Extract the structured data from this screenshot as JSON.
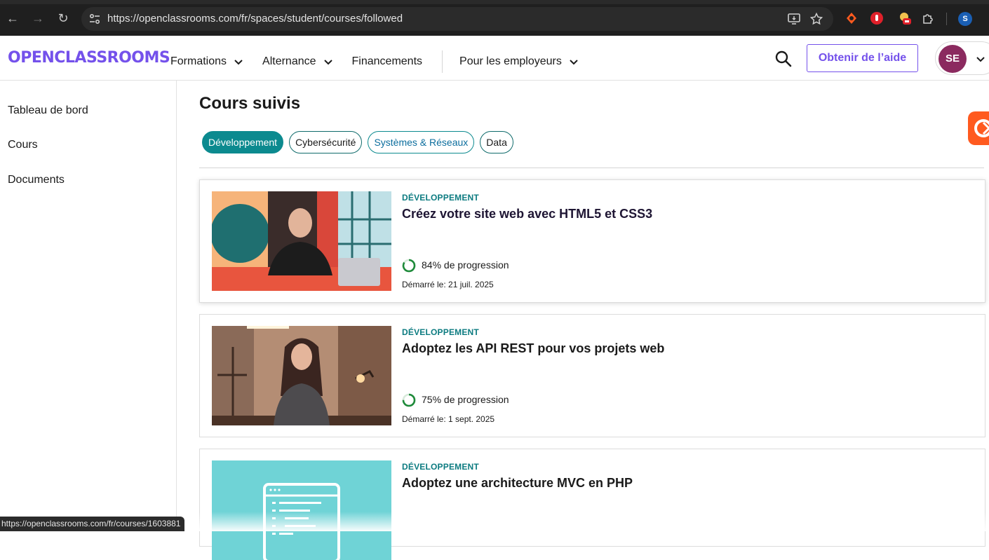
{
  "browser": {
    "url": "https://openclassrooms.com/fr/spaces/student/courses/followed",
    "profile_initial": "S",
    "status_url": "https://openclassrooms.com/fr/courses/1603881"
  },
  "header": {
    "logo": "OPENCLASSROOMS",
    "nav": [
      {
        "label": "Formations"
      },
      {
        "label": "Alternance"
      },
      {
        "label": "Financements"
      },
      {
        "label": "Pour les employeurs"
      }
    ],
    "help_label": "Obtenir de l’aide",
    "avatar_initials": "SE"
  },
  "sidebar": {
    "items": [
      {
        "label": "Tableau de bord"
      },
      {
        "label": "Cours"
      },
      {
        "label": "Documents"
      }
    ]
  },
  "main": {
    "title": "Cours suivis",
    "filters": [
      {
        "label": "Développement",
        "active": true
      },
      {
        "label": "Cybersécurité",
        "active": false
      },
      {
        "label": "Systèmes & Réseaux",
        "active": false
      },
      {
        "label": "Data",
        "active": false
      }
    ],
    "courses": [
      {
        "category": "DÉVELOPPEMENT",
        "title": "Créez votre site web avec HTML5 et CSS3",
        "progress": 84,
        "progress_text": "84% de progression",
        "started": "Démarré le: 21 juil. 2025"
      },
      {
        "category": "DÉVELOPPEMENT",
        "title": "Adoptez les API REST pour vos projets web",
        "progress": 75,
        "progress_text": "75% de progression",
        "started": "Démarré le: 1 sept. 2025"
      },
      {
        "category": "DÉVELOPPEMENT",
        "title": "Adoptez une architecture MVC en PHP"
      }
    ]
  },
  "colors": {
    "brand": "#7451eb",
    "teal": "#0c8a8f",
    "progress_green": "#1e8a3a"
  }
}
